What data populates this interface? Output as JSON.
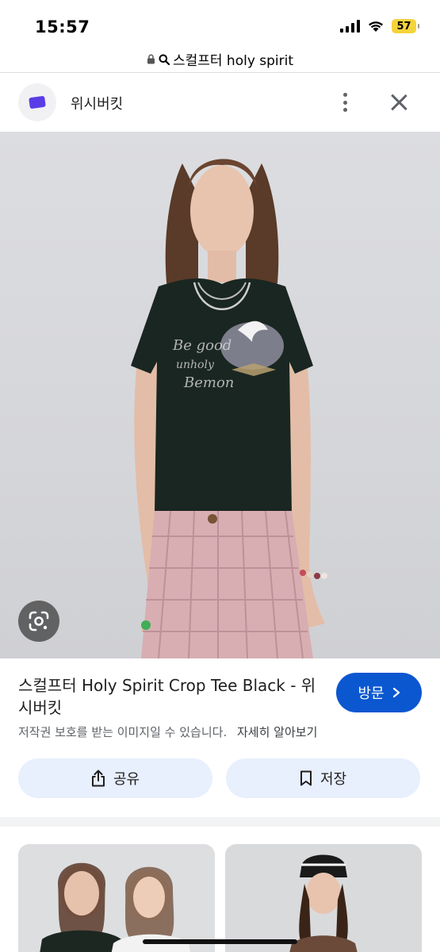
{
  "status_bar": {
    "time": "15:57",
    "battery": "57",
    "icons": [
      "signal-icon",
      "wifi-icon",
      "battery-icon"
    ]
  },
  "url_bar": {
    "text": "스컬프터 holy spirit",
    "icons": [
      "lock-icon",
      "search-icon"
    ]
  },
  "site_header": {
    "name": "위시버킷",
    "icons": [
      "site-logo-icon",
      "more-vert-icon",
      "close-icon"
    ]
  },
  "main_image": {
    "icons": [
      "lens-icon"
    ]
  },
  "product": {
    "title": "스컬프터 Holy Spirit Crop Tee Black - 위시버킷",
    "visit_label": "방문",
    "copyright_notice": "저작권 보호를 받는 이미지일 수 있습니다.",
    "learn_more": "자세히 알아보기"
  },
  "actions": {
    "share_label": "공유",
    "save_label": "저장"
  },
  "colors": {
    "accent_blue": "#0b57d0",
    "pill_bg": "#e8effd",
    "battery": "#f5d33b"
  }
}
